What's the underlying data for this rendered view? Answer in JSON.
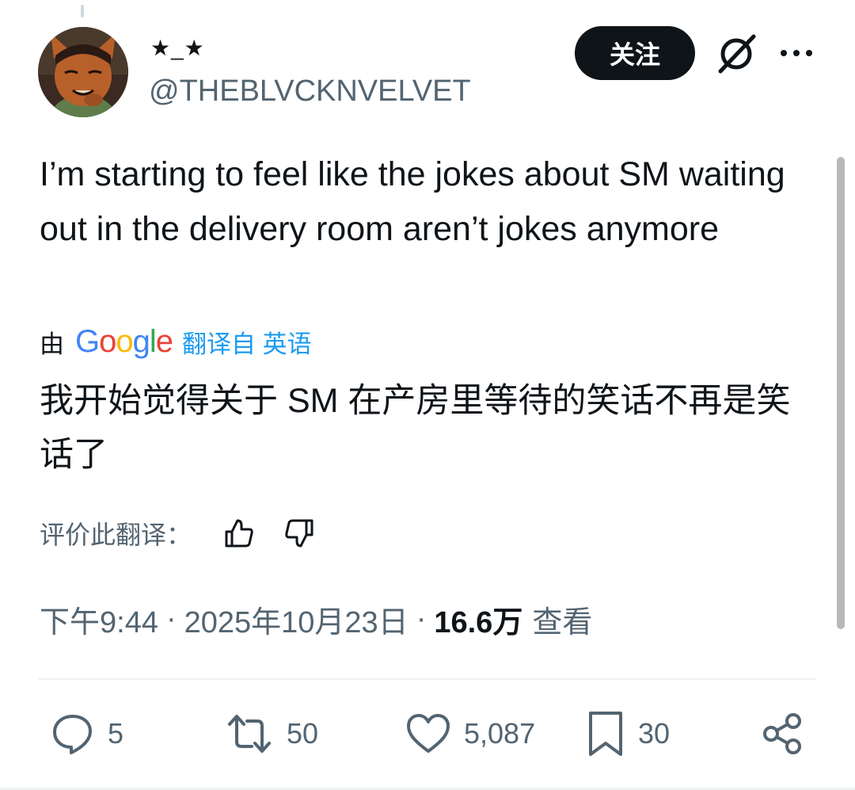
{
  "author": {
    "display_name": "★_★",
    "handle": "@THEBLVCKNVELVET"
  },
  "header": {
    "follow_label": "关注",
    "grok_icon": "grok-icon",
    "more_icon": "more-dots-icon"
  },
  "tweet": {
    "text": "I’m starting to feel like the jokes about SM waiting out in the delivery room aren’t jokes anymore"
  },
  "translation": {
    "by_label": "由",
    "provider": "Google",
    "source_label": "翻译自 英语",
    "text": "我开始觉得关于 SM 在产房里等待的笑话不再是笑话了",
    "rate_label": "评价此翻译：",
    "thumbs_up_icon": "thumbs-up-icon",
    "thumbs_down_icon": "thumbs-down-icon"
  },
  "meta": {
    "time": "下午9:44",
    "separator": "·",
    "date": "2025年10月23日",
    "views_count": "16.6万",
    "views_label": "查看"
  },
  "actions": {
    "replies": "5",
    "reposts": "50",
    "likes": "5,087",
    "bookmarks": "30",
    "share_icon": "share-icon"
  },
  "colors": {
    "accent": "#1d9bf0",
    "text_primary": "#0f1419",
    "text_secondary": "#536471",
    "button_bg": "#0f1419"
  }
}
